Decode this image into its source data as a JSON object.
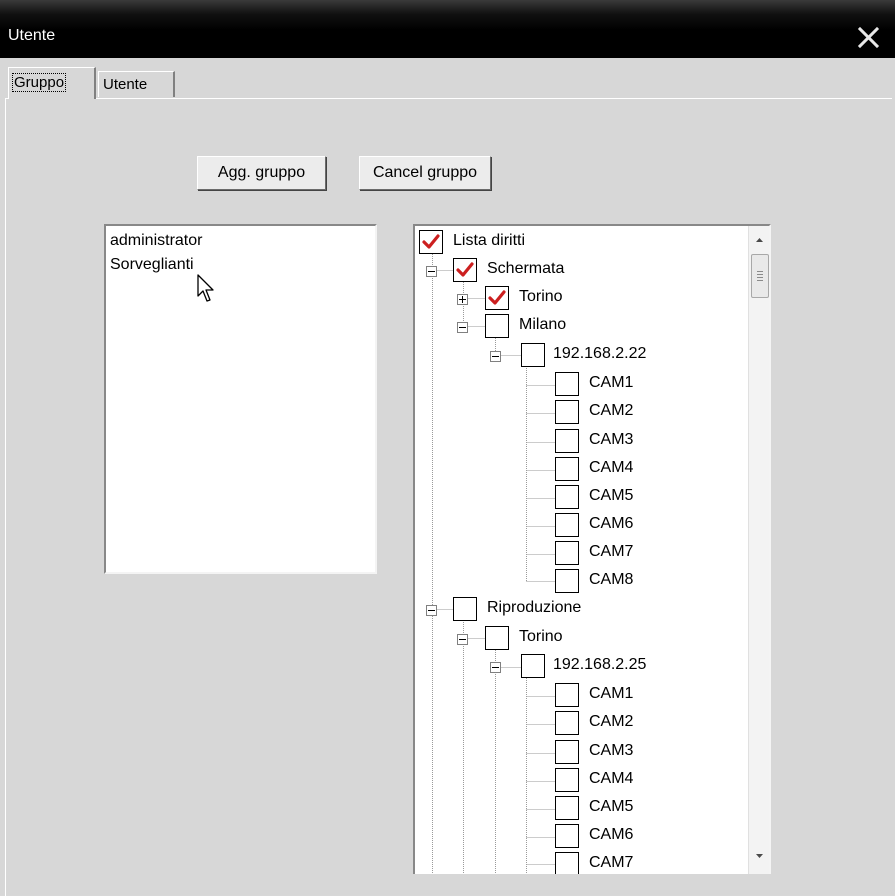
{
  "window": {
    "title": "Utente"
  },
  "tabs": [
    "Gruppo",
    "Utente"
  ],
  "buttons": {
    "add_group": "Agg. gruppo",
    "cancel_group": "Cancel gruppo"
  },
  "groups": [
    "administrator",
    "Sorveglianti"
  ],
  "tree": {
    "root": {
      "label": "Lista diritti",
      "checked": true
    },
    "schermata": {
      "label": "Schermata",
      "checked": true,
      "expanded": true
    },
    "schermata_torino": {
      "label": "Torino",
      "checked": true,
      "expanded": false
    },
    "schermata_milano": {
      "label": "Milano",
      "checked": false,
      "expanded": true
    },
    "milano_ip": {
      "label": "192.168.2.22",
      "checked": false,
      "expanded": true
    },
    "milano_cams": [
      "CAM1",
      "CAM2",
      "CAM3",
      "CAM4",
      "CAM5",
      "CAM6",
      "CAM7",
      "CAM8"
    ],
    "riproduzione": {
      "label": "Riproduzione",
      "checked": false,
      "expanded": true
    },
    "riproduzione_torino": {
      "label": "Torino",
      "checked": false,
      "expanded": true
    },
    "torino_ip": {
      "label": "192.168.2.25",
      "checked": false,
      "expanded": true
    },
    "torino_cams": [
      "CAM1",
      "CAM2",
      "CAM3",
      "CAM4",
      "CAM5",
      "CAM6",
      "CAM7"
    ]
  },
  "colors": {
    "check": "#cc1f1f",
    "titlebar": "#000000",
    "background": "#d7d7d7"
  }
}
